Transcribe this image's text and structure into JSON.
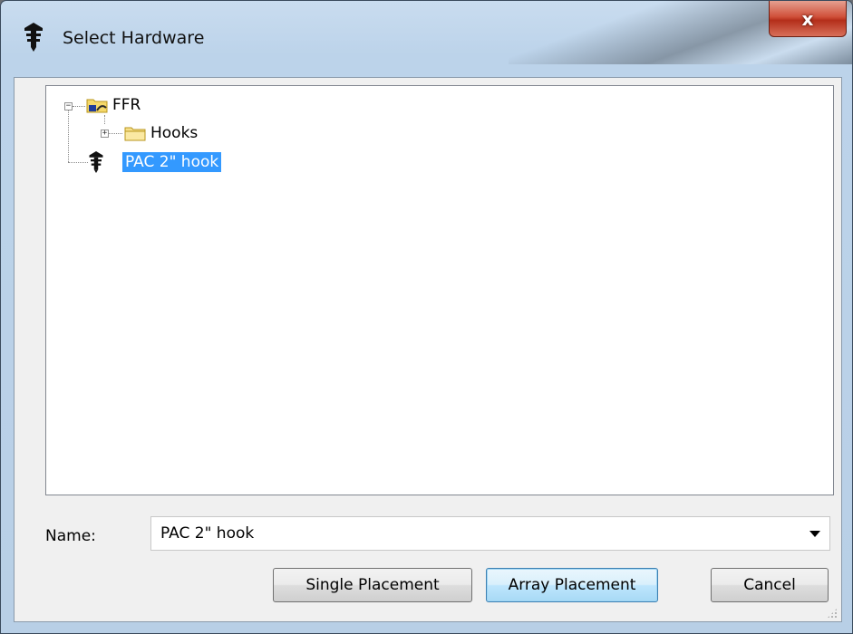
{
  "window": {
    "title": "Select Hardware",
    "close_glyph": "x"
  },
  "tree": {
    "root": {
      "label": "FFR",
      "expanded": true,
      "icon": "shared-folder-icon",
      "children": [
        {
          "label": "Hooks",
          "icon": "folder-icon",
          "expanded": false
        },
        {
          "label": "PAC 2\" hook",
          "icon": "hardware-pin-icon",
          "selected": true
        }
      ]
    }
  },
  "name_field": {
    "label": "Name:",
    "value": "PAC 2\" hook"
  },
  "buttons": {
    "single": "Single Placement",
    "array": "Array Placement",
    "cancel": "Cancel"
  },
  "colors": {
    "selection": "#3399ff",
    "close_button": "#c94a36",
    "default_button_border": "#3c7fb1"
  }
}
